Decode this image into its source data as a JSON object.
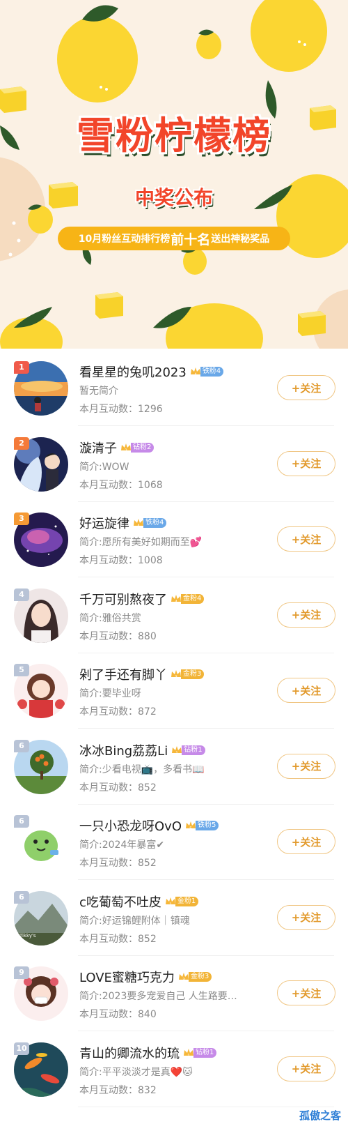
{
  "banner": {
    "title": "雪粉柠檬榜",
    "subtitle": "中奖公布",
    "tagline_pre": "10月粉丝互动排行榜",
    "tagline_hl": "前十名",
    "tagline_post": "送出神秘奖品",
    "colors": {
      "lemon": "#fbd632",
      "leaf": "#2e5a2a",
      "cream": "#fbf1e4",
      "cube": "#f8d22a",
      "title_red": "#f2452a",
      "tagline_bg": "#f7b416"
    }
  },
  "follow_label": "+关注",
  "rank_colors": {
    "1": "#f05a4a",
    "2": "#f47a3a",
    "3": "#f59a35",
    "default": "#b8c3d6"
  },
  "users": [
    {
      "rank": "1",
      "name": "看星星的兔叽2023",
      "badge": "铁粉4",
      "badge_color": "#6aa8e8",
      "badge_num": "4",
      "bio": "暂无简介",
      "stat": "本月互动数：1296",
      "avatar": "sunset-child"
    },
    {
      "rank": "2",
      "name": "漩清子",
      "badge": "钻粉2",
      "badge_color": "#c68ae8",
      "badge_num": "2",
      "bio": "简介:WOW",
      "stat": "本月互动数：1068",
      "avatar": "anime-night"
    },
    {
      "rank": "3",
      "name": "好运旋律",
      "badge": "铁粉4",
      "badge_color": "#6aa8e8",
      "badge_num": "4",
      "bio": "简介:愿所有美好如期而至💕",
      "stat": "本月互动数：1008",
      "avatar": "nebula"
    },
    {
      "rank": "4",
      "name": "千万可别熬夜了",
      "badge": "金粉4",
      "badge_color": "#f2b437",
      "badge_num": "4",
      "bio": "简介:雅俗共赏",
      "stat": "本月互动数：880",
      "avatar": "girl-portrait"
    },
    {
      "rank": "5",
      "name": "剁了手还有脚丫",
      "badge": "金粉3",
      "badge_color": "#f2b437",
      "badge_num": "3",
      "bio": "简介:要毕业呀",
      "stat": "本月互动数：872",
      "avatar": "cartoon-girl"
    },
    {
      "rank": "6",
      "name": "冰冰Bing荔荔Li",
      "badge": "钻粉1",
      "badge_color": "#c68ae8",
      "badge_num": "1",
      "bio": "简介:少看电视📺，多看书📖",
      "stat": "本月互动数：852",
      "avatar": "persimmon-tree"
    },
    {
      "rank": "6",
      "name": "一只小恐龙呀OvO",
      "badge": "铁粉5",
      "badge_color": "#6aa8e8",
      "badge_num": "5",
      "bio": "简介:2024年暴富✔",
      "stat": "本月互动数：852",
      "avatar": "green-dino"
    },
    {
      "rank": "6",
      "name": "c吃葡萄不吐皮",
      "badge": "金粉1",
      "badge_color": "#f2b437",
      "badge_num": "1",
      "bio": "简介:好运锦鲤附体｜镇魂",
      "stat": "本月互动数：852",
      "avatar": "mountain-text"
    },
    {
      "rank": "9",
      "name": "LOVE蜜糖巧克力",
      "badge": "金粉3",
      "badge_color": "#f2b437",
      "badge_num": "3",
      "bio": "简介:2023要多宠爱自己 人生路要…",
      "stat": "本月互动数：840",
      "avatar": "masked-girl"
    },
    {
      "rank": "10",
      "name": "青山的卿流水的琉",
      "badge": "钻粉1",
      "badge_color": "#c68ae8",
      "badge_num": "1",
      "bio": "简介:平平淡淡才是真❤️🐱",
      "stat": "本月互动数：832",
      "avatar": "koi-fish"
    }
  ],
  "watermark": "孤傲之客"
}
